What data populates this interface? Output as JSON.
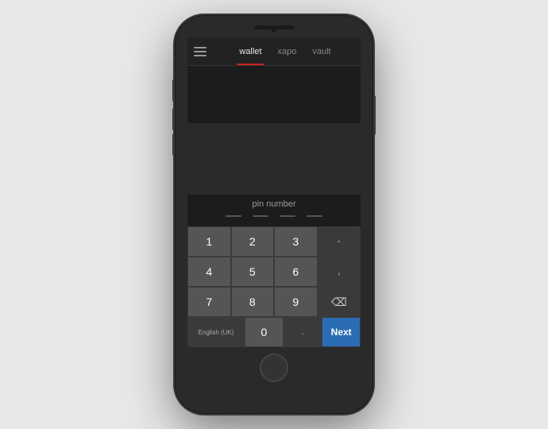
{
  "nav": {
    "menu_icon": "menu",
    "tabs": [
      {
        "label": "wallet",
        "active": true
      },
      {
        "label": "xapo",
        "active": false
      },
      {
        "label": "vault",
        "active": false
      }
    ]
  },
  "pin": {
    "label": "pin number",
    "dots": 4
  },
  "keyboard": {
    "rows": [
      [
        {
          "label": "1",
          "type": "number"
        },
        {
          "label": "2",
          "type": "number"
        },
        {
          "label": "3",
          "type": "number"
        },
        {
          "label": "-",
          "type": "dark"
        }
      ],
      [
        {
          "label": "4",
          "type": "number"
        },
        {
          "label": "5",
          "type": "number"
        },
        {
          "label": "6",
          "type": "number"
        },
        {
          "label": ",",
          "type": "dark"
        }
      ],
      [
        {
          "label": "7",
          "type": "number"
        },
        {
          "label": "8",
          "type": "number"
        },
        {
          "label": "9",
          "type": "number"
        },
        {
          "label": "⌫",
          "type": "dark"
        }
      ],
      [
        {
          "label": "English (UK)",
          "type": "lang"
        },
        {
          "label": "0",
          "type": "number"
        },
        {
          "label": ".",
          "type": "dark"
        },
        {
          "label": "Next",
          "type": "blue"
        }
      ]
    ]
  }
}
